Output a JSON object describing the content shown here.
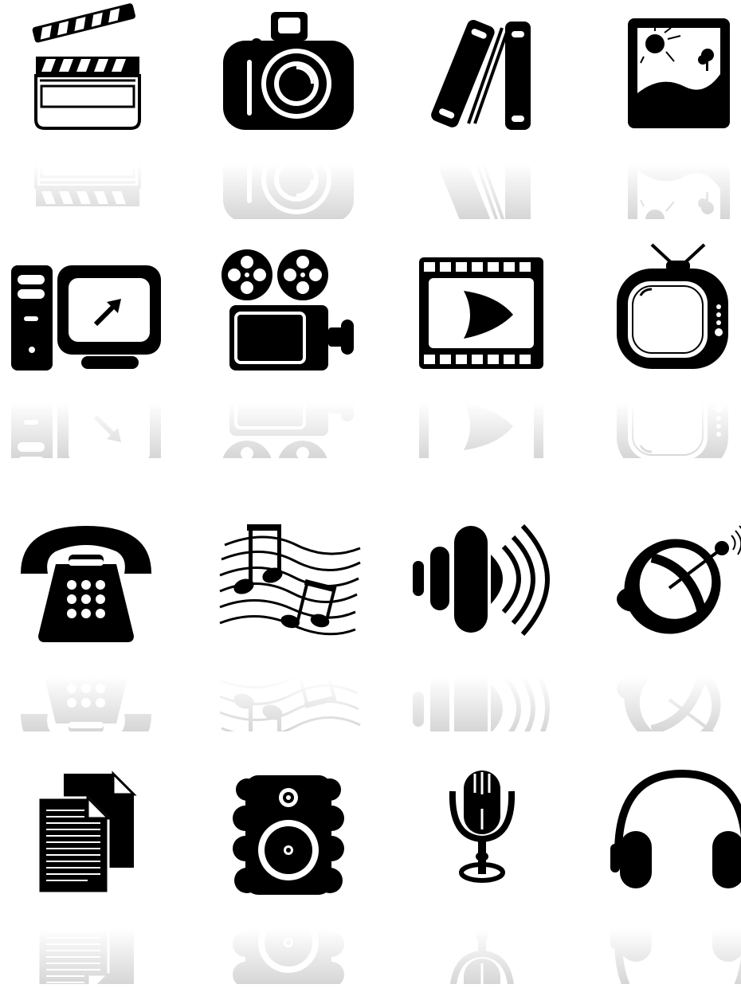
{
  "icons": [
    {
      "name": "clapperboard-icon"
    },
    {
      "name": "camera-icon"
    },
    {
      "name": "books-icon"
    },
    {
      "name": "landscape-picture-icon"
    },
    {
      "name": "desktop-computer-icon"
    },
    {
      "name": "film-projector-icon"
    },
    {
      "name": "video-play-icon"
    },
    {
      "name": "retro-tv-icon"
    },
    {
      "name": "telephone-icon"
    },
    {
      "name": "music-notes-icon"
    },
    {
      "name": "sound-waves-icon"
    },
    {
      "name": "satellite-dish-icon"
    },
    {
      "name": "documents-icon"
    },
    {
      "name": "speaker-icon"
    },
    {
      "name": "microphone-icon"
    },
    {
      "name": "headphones-icon"
    }
  ],
  "colors": {
    "icon": "#000000",
    "background": "#ffffff"
  }
}
